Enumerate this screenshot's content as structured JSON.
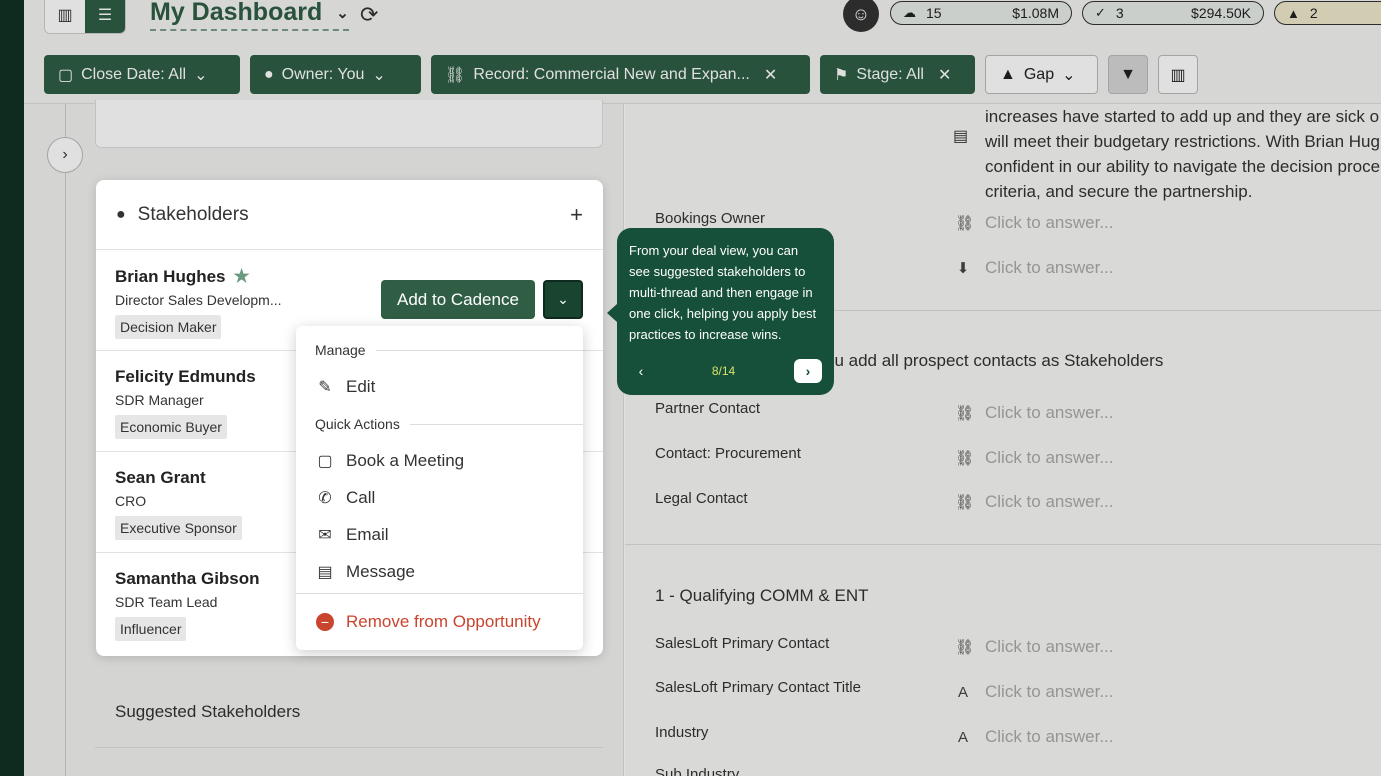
{
  "header": {
    "title": "My Dashboard",
    "stats": [
      {
        "icon": "cloud-icon",
        "count": "15",
        "amount": "$1.08M"
      },
      {
        "icon": "check-icon",
        "count": "3",
        "amount": "$294.50K"
      },
      {
        "icon": "warning-icon",
        "count": "2",
        "amount": "$"
      }
    ]
  },
  "filters": {
    "close_date": "Close Date: All",
    "owner": "Owner: You",
    "record": "Record: Commercial New and Expan...",
    "stage": "Stage: All",
    "gap": "Gap"
  },
  "stakeholders": {
    "title": "Stakeholders",
    "add_to_cadence": "Add to Cadence",
    "people": [
      {
        "name": "Brian Hughes",
        "title": "Director Sales Developm...",
        "role": "Decision Maker"
      },
      {
        "name": "Felicity Edmunds",
        "title": "SDR Manager",
        "role": "Economic Buyer"
      },
      {
        "name": "Sean Grant",
        "title": "CRO",
        "role": "Executive Sponsor"
      },
      {
        "name": "Samantha Gibson",
        "title": "SDR Team Lead",
        "role": "Influencer"
      }
    ],
    "suggested_title": "Suggested Stakeholders"
  },
  "menu": {
    "manage_label": "Manage",
    "edit": "Edit",
    "quick_actions_label": "Quick Actions",
    "book_meeting": "Book a Meeting",
    "call": "Call",
    "email": "Email",
    "message": "Message",
    "remove": "Remove from Opportunity"
  },
  "tooltip": {
    "text": "From your deal view, you can see suggested stakeholders to multi-thread and then engage in one click, helping you apply best practices to increase wins.",
    "counter": "8/14"
  },
  "right": {
    "text_lines": "increases have started to add up and they are sick o\nwill meet their budgetary restrictions. With Brian Hug\nconfident in our ability to navigate the decision proce\ncriteria, and secure the partnership.",
    "bookings_owner": "Bookings Owner",
    "placeholder": "Click to answer...",
    "section_partial": "ou add all prospect contacts as Stakeholders",
    "partner_contact": "Partner Contact",
    "contact_procurement": "Contact: Procurement",
    "legal_contact": "Legal Contact",
    "section_qualifying": "1 - Qualifying COMM & ENT",
    "primary_contact": "SalesLoft Primary Contact",
    "primary_contact_title": "SalesLoft Primary Contact Title",
    "industry": "Industry",
    "sub_industry": "Sub Industry"
  },
  "colors": {
    "brand_green": "#2f5e45",
    "tooltip_bg": "#17503a",
    "danger": "#c9452e"
  }
}
